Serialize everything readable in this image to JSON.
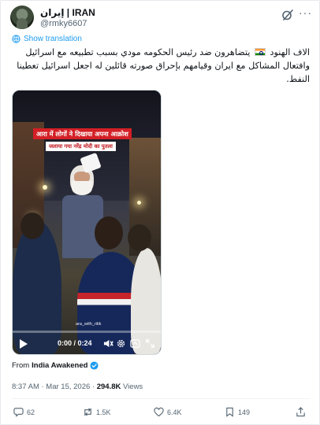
{
  "author": {
    "display_name": "إيران | IRAN",
    "handle": "@rmky6607"
  },
  "translate": {
    "label": "Show translation"
  },
  "tweet": {
    "text_part1": "الاف الهنود",
    "text_part2": "يتضاهرون ضد رئيس الحكومه  مودي بسبب تطبيعه مع اسرائيل وافتعال المشاكل مع ايران وقيامهم بإحراق صورته قائلين له اجعل اسرائيل تعطينا النفط."
  },
  "video": {
    "banner_line1": "आरा में लोगों ने दिखाया अपना आक्रोश",
    "banner_line2": "जलाया गया नरेंद्र मोदी का पुतला",
    "watermark": "ara_with_ritik",
    "time_display": "0:00 / 0:24",
    "progress_fraction": 0
  },
  "source": {
    "prefix": "From",
    "name": "India Awakened"
  },
  "meta": {
    "timestamp": "8:37 AM · Mar 15, 2026 · ",
    "views_count": "294.8K",
    "views_label": " Views"
  },
  "actions": {
    "replies": "62",
    "reposts": "1.5K",
    "likes": "6.4K",
    "bookmarks": "149"
  },
  "colors": {
    "accent": "#1d9bf0",
    "secondary_text": "#536471",
    "banner_red": "#d31f25"
  },
  "icons": [
    "grok-icon",
    "more-icon",
    "translate-icon",
    "play-icon",
    "volume-icon",
    "settings-icon",
    "captions-icon",
    "fullscreen-icon",
    "verified-icon",
    "reply-icon",
    "repost-icon",
    "like-icon",
    "bookmark-icon",
    "share-icon"
  ]
}
